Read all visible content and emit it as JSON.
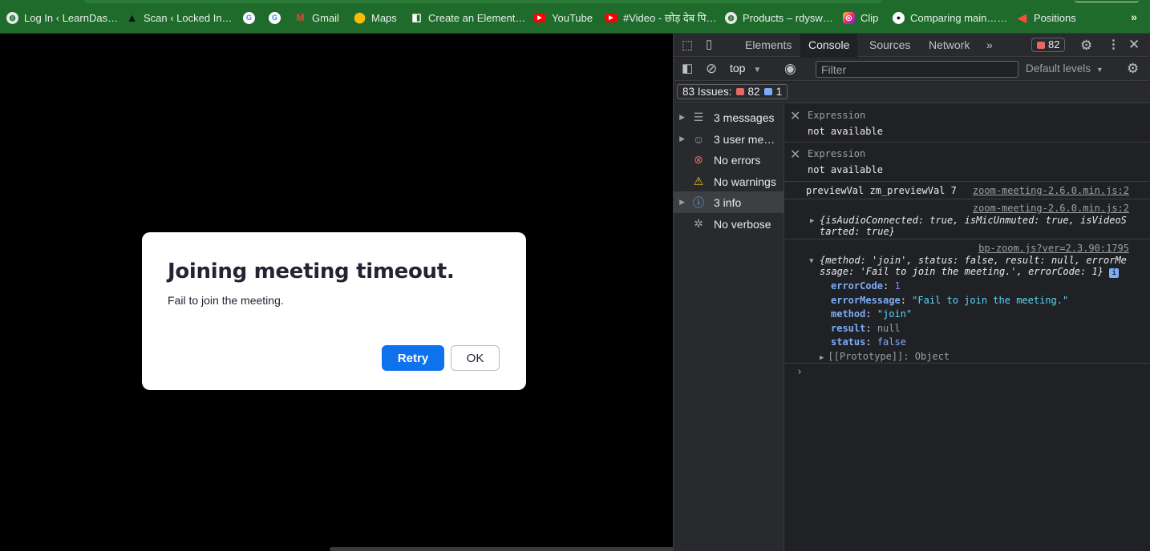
{
  "bookmarks": [
    {
      "label": "Log In ‹ LearnDas…",
      "icon": "globe-icon"
    },
    {
      "label": "Scan ‹ Locked In…",
      "icon": "lock-icon"
    },
    {
      "label": "",
      "icon": "google-icon"
    },
    {
      "label": "",
      "icon": "google-icon"
    },
    {
      "label": "Gmail",
      "icon": "gmail-icon"
    },
    {
      "label": "Maps",
      "icon": "maps-icon"
    },
    {
      "label": "Create an Element…",
      "icon": "element-icon"
    },
    {
      "label": "YouTube",
      "icon": "youtube-icon"
    },
    {
      "label": "#Video - छोड़ देब पि…",
      "icon": "youtube-icon"
    },
    {
      "label": "Products – rdysw…",
      "icon": "globe-icon"
    },
    {
      "label": "Clip",
      "icon": "clip-icon"
    },
    {
      "label": "Comparing main……",
      "icon": "github-icon"
    },
    {
      "label": "Positions",
      "icon": "positions-icon"
    }
  ],
  "bookmarks_more": "»",
  "dialog": {
    "title": "Joining meeting timeout.",
    "message": "Fail to join the meeting.",
    "retry_label": "Retry",
    "ok_label": "OK"
  },
  "devtools": {
    "tabs": {
      "elements": "Elements",
      "console": "Console",
      "sources": "Sources",
      "network": "Network",
      "more": "»"
    },
    "error_count": "82",
    "context": "top",
    "filter_placeholder": "Filter",
    "levels_label": "Default levels",
    "issues": {
      "label": "83 Issues:",
      "errors": "82",
      "infos": "1"
    },
    "sidebar": [
      {
        "label": "3 messages",
        "icon": "list-icon"
      },
      {
        "label": "3 user me…",
        "icon": "user-icon"
      },
      {
        "label": "No errors",
        "icon": "error-icon"
      },
      {
        "label": "No warnings",
        "icon": "warning-icon"
      },
      {
        "label": "3 info",
        "icon": "info-icon"
      },
      {
        "label": "No verbose",
        "icon": "bug-icon"
      }
    ],
    "console": {
      "expr1": {
        "label": "Expression",
        "value": "not available"
      },
      "expr2": {
        "label": "Expression",
        "value": "not available"
      },
      "log1": {
        "text": "previewVal zm_previewVal 7",
        "source": "zoom-meeting-2.6.0.min.js:2"
      },
      "log2": {
        "source": "zoom-meeting-2.6.0.min.js:2",
        "obj_line1": "{isAudioConnected: true, isMicUnmuted: true, isVideoS",
        "obj_line2": "tarted: true}"
      },
      "log3": {
        "source": "bp-zoom.js?ver=2.3.90:1795",
        "obj_line1": "{method: 'join', status: false, result: null, errorMe",
        "obj_line2": "ssage: 'Fail to join the meeting.', errorCode: 1}",
        "props": [
          {
            "key": "errorCode",
            "value": "1"
          },
          {
            "key": "errorMessage",
            "value": "\"Fail to join the meeting.\""
          },
          {
            "key": "method",
            "value": "\"join\""
          },
          {
            "key": "result",
            "value": "null"
          },
          {
            "key": "status",
            "value": "false"
          }
        ],
        "prototype": "[[Prototype]]: Object"
      },
      "prompt": "›"
    }
  },
  "colors": {
    "bookmark_bar": "#1f6b2c",
    "retry_button": "#0e72ed",
    "devtools_bg": "#202124"
  }
}
